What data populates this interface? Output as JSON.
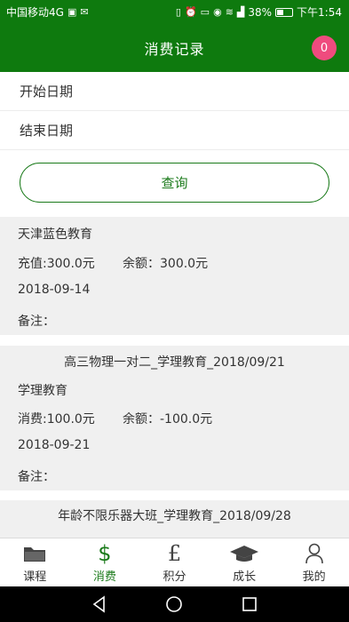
{
  "status_bar": {
    "carrier": "中国移动4G",
    "signal_label": "4G",
    "battery": "38%",
    "time": "下午1:54"
  },
  "header": {
    "title": "消费记录",
    "badge_count": "0"
  },
  "filters": {
    "start_date_label": "开始日期",
    "end_date_label": "结束日期",
    "query_button": "查询"
  },
  "records": [
    {
      "title": "天津蓝色教育",
      "amount_label": "充值:300.0元",
      "balance_label": "余额：300.0元",
      "date": "2018-09-14",
      "note": "备注："
    },
    {
      "title": "高三物理一对二_学理教育_2018/09/21",
      "school": "学理教育",
      "amount_label": "消费:100.0元",
      "balance_label": "余额：-100.0元",
      "date": "2018-09-21",
      "note": "备注："
    },
    {
      "title": "年龄不限乐器大班_学理教育_2018/09/28"
    }
  ],
  "tabs": [
    {
      "label": "课程",
      "icon": "folder-icon"
    },
    {
      "label": "消费",
      "icon": "dollar-icon"
    },
    {
      "label": "积分",
      "icon": "pound-icon"
    },
    {
      "label": "成长",
      "icon": "graduation-cap-icon"
    },
    {
      "label": "我的",
      "icon": "user-icon"
    }
  ],
  "colors": {
    "brand_green": "#0e7a0e",
    "badge_pink": "#ef4b7e",
    "active_tab": "#1a7a1a",
    "card_bg": "#f0f0f0"
  }
}
